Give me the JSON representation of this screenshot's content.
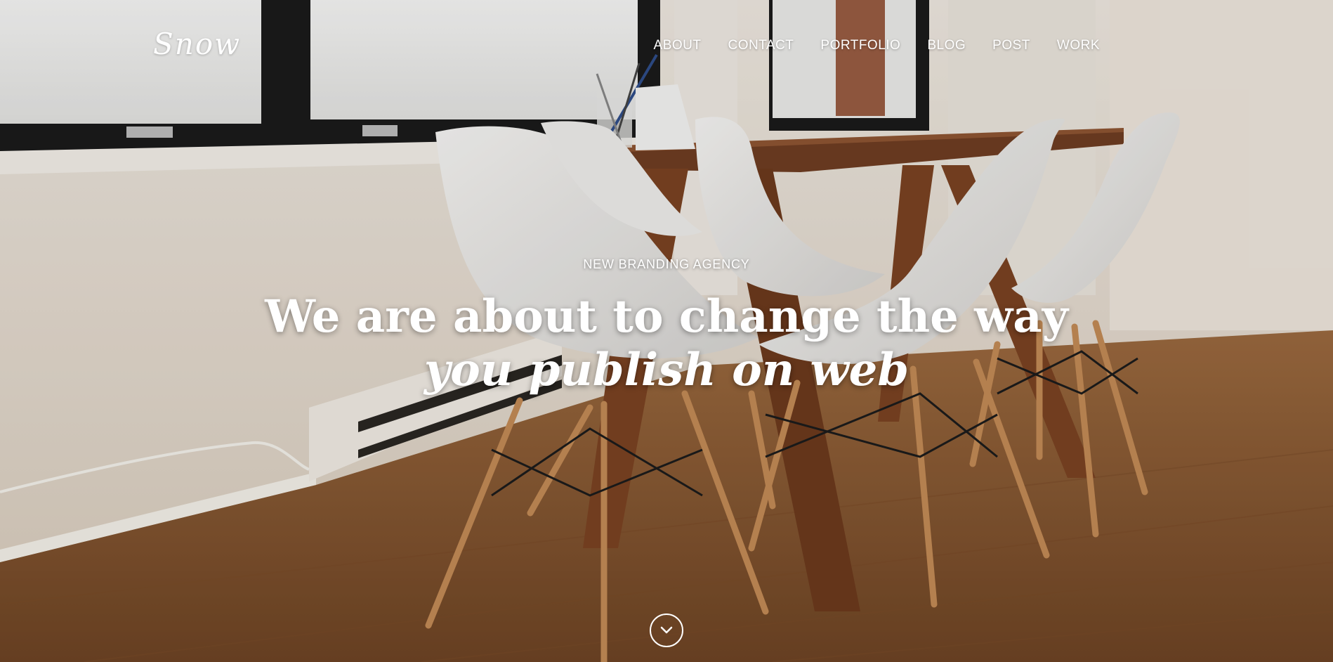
{
  "logo": {
    "text": "Snow"
  },
  "nav": {
    "items": [
      {
        "label": "ABOUT"
      },
      {
        "label": "CONTACT"
      },
      {
        "label": "PORTFOLIO"
      },
      {
        "label": "BLOG"
      },
      {
        "label": "POST"
      },
      {
        "label": "WORK"
      }
    ]
  },
  "hero": {
    "tagline": "NEW BRANDING AGENCY",
    "headline_line1": "We are about to change the way",
    "headline_line2": "you publish on web",
    "scroll_icon": "chevron-down-icon"
  },
  "colors": {
    "text": "#ffffff",
    "wall": "#e9e1d6",
    "floor": "#8a5a34",
    "chair": "#f2f1ef",
    "table": "#7a4526"
  }
}
